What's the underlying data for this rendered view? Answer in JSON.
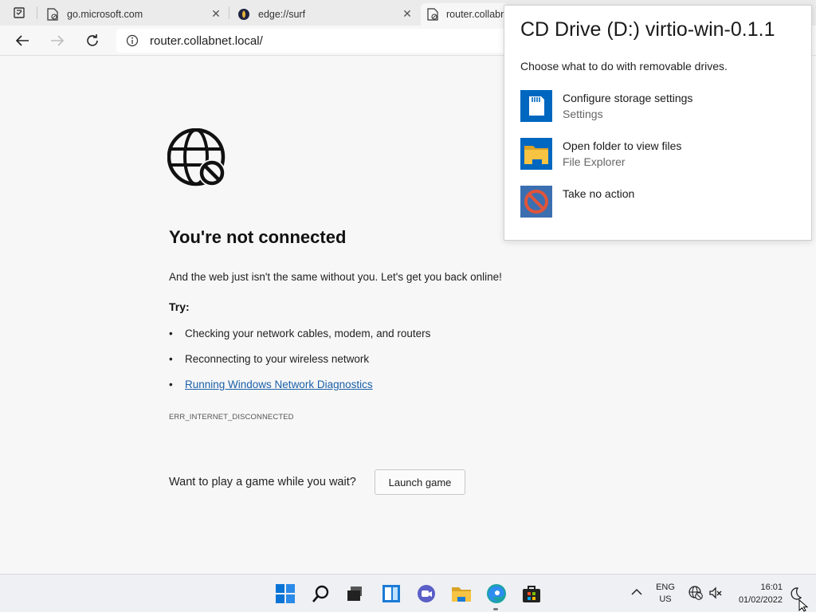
{
  "tabs": [
    {
      "title": "go.microsoft.com",
      "close": "✕"
    },
    {
      "title": "edge://surf",
      "close": "✕"
    },
    {
      "title": "router.collabnet.local/"
    }
  ],
  "address": {
    "url": "router.collabnet.local/"
  },
  "error_page": {
    "title": "You're not connected",
    "subtitle": "And the web just isn't the same without you. Let's get you back online!",
    "try_label": "Try:",
    "bullets": [
      "Checking your network cables, modem, and routers",
      "Reconnecting to your wireless network",
      "Running Windows Network Diagnostics"
    ],
    "bullet_char": "•",
    "error_code": "ERR_INTERNET_DISCONNECTED",
    "game_question": "Want to play a game while you wait?",
    "launch_label": "Launch game"
  },
  "autoplay": {
    "title": "CD Drive (D:) virtio-win-0.1.1",
    "subtitle": "Choose what to do with removable drives.",
    "options": [
      {
        "name": "Configure storage settings",
        "desc": "Settings",
        "icon": "sd-card-icon"
      },
      {
        "name": "Open folder to view files",
        "desc": "File Explorer",
        "icon": "folder-icon"
      },
      {
        "name": "Take no action",
        "desc": "",
        "icon": "no-action-icon"
      }
    ]
  },
  "taskbar": {
    "apps": [
      "windows-start-icon",
      "search-icon",
      "task-view-icon",
      "widgets-icon",
      "chat-icon",
      "file-explorer-icon",
      "edge-icon",
      "store-icon"
    ],
    "lang_line1": "ENG",
    "lang_line2": "US",
    "time": "16:01",
    "date": "01/02/2022"
  },
  "colors": {
    "accent": "#0067c0",
    "link": "#1a5fa8",
    "folder": "#f6c342"
  }
}
